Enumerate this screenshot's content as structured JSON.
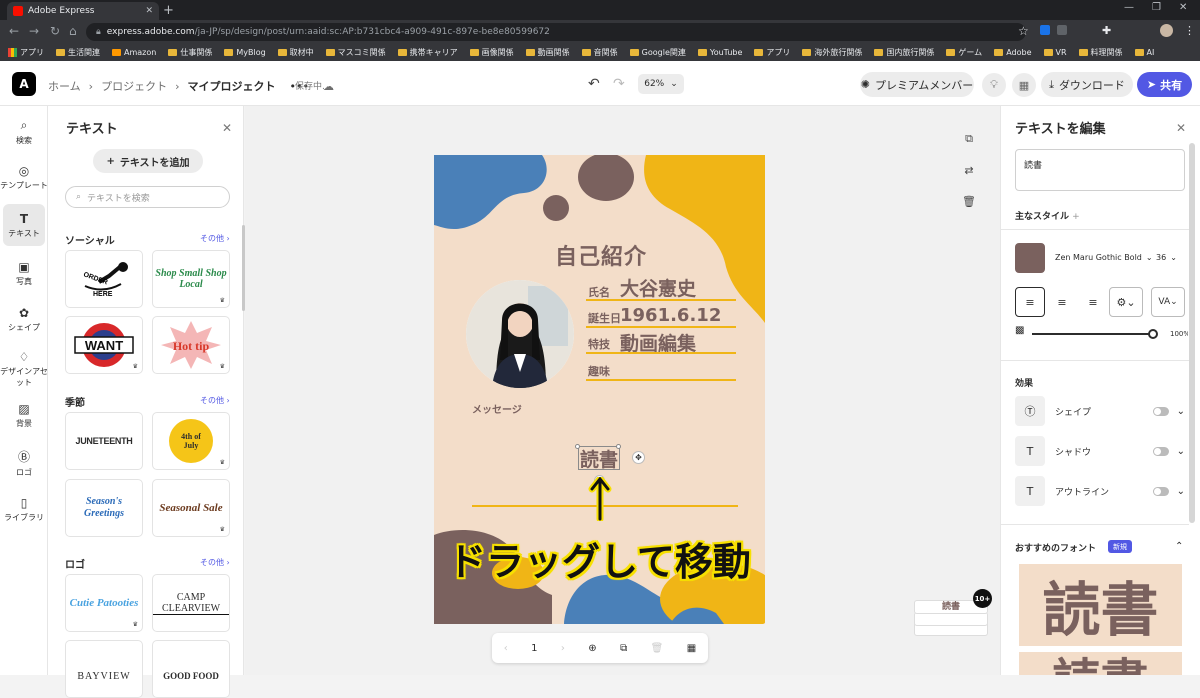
{
  "browser": {
    "tab_title": "Adobe Express",
    "url_host": "express.adobe.com",
    "url_path": "/ja-JP/sp/design/post/urn:aaid:sc:AP:b731cbc4-a909-491c-897e-be8e80599672",
    "bookmarks": [
      "アプリ",
      "生活関連",
      "Amazon",
      "仕事関係",
      "MyBlog",
      "取材中",
      "マスコミ関係",
      "携帯キャリア",
      "画像関係",
      "動画関係",
      "音関係",
      "Google関連",
      "YouTube",
      "アプリ",
      "海外旅行関係",
      "国内旅行関係",
      "ゲーム",
      "Adobe",
      "VR",
      "料理関係",
      "AI"
    ]
  },
  "header": {
    "breadcrumb": [
      "ホーム",
      "プロジェクト",
      "マイプロジェクト"
    ],
    "more": "•••",
    "saving": "保存中...",
    "zoom": "62%",
    "premium": "プレミアムメンバー",
    "download": "ダウンロード",
    "share": "共有"
  },
  "rail": [
    {
      "label": "検索",
      "icon": "search-icon"
    },
    {
      "label": "テンプレート",
      "icon": "template-icon"
    },
    {
      "label": "テキスト",
      "icon": "text-icon"
    },
    {
      "label": "写真",
      "icon": "photo-icon"
    },
    {
      "label": "シェイプ",
      "icon": "shape-icon"
    },
    {
      "label": "デザインアセット",
      "icon": "design-assets-icon"
    },
    {
      "label": "背景",
      "icon": "background-icon"
    },
    {
      "label": "ロゴ",
      "icon": "logo-icon"
    },
    {
      "label": "ライブラリ",
      "icon": "library-icon"
    }
  ],
  "left_panel": {
    "title": "テキスト",
    "add_text": "テキストを追加",
    "search_placeholder": "テキストを検索",
    "sections": [
      {
        "title": "ソーシャル",
        "more": "その他 ›",
        "cards": [
          "ORDER HERE",
          "Shop Small Shop Local",
          "WANT",
          "Hot tip"
        ]
      },
      {
        "title": "季節",
        "more": "その他 ›",
        "cards": [
          "JUNETEENTH",
          "4th of July",
          "Season's Greetings",
          "Seasonal Sale"
        ]
      },
      {
        "title": "ロゴ",
        "more": "その他 ›",
        "cards": [
          "Cutie Patooties",
          "CAMP CLEARVIEW",
          "BAYVIEW",
          "GOOD FOOD"
        ]
      }
    ]
  },
  "design": {
    "title": "自己紹介",
    "name_label": "氏名",
    "name_value": "大谷憲史",
    "birth_label": "誕生日",
    "birth_value": "1961.6.12",
    "skill_label": "特技",
    "skill_value": "動画編集",
    "hobby_label": "趣味",
    "message_label": "メッセージ",
    "selected_text": "読書",
    "annotation": "ドラッグして移動",
    "colors": {
      "blue": "#4a80b8",
      "yellow": "#f0b516",
      "brown": "#7a615e",
      "bg": "#f3ddc9"
    }
  },
  "pagebar": {
    "page": "1"
  },
  "thumbs": {
    "badge": "10+",
    "label": "読書"
  },
  "right_panel": {
    "title": "テキストを編集",
    "text_value": "読書",
    "main_style": "主なスタイル",
    "font_name": "Zen Maru Gothic Bold",
    "font_size": "36",
    "opacity": "100%",
    "effects_title": "効果",
    "effects": [
      "シェイプ",
      "シャドウ",
      "アウトライン"
    ],
    "recommended": "おすすめのフォント",
    "new_badge": "新規",
    "preview_text": "読書"
  }
}
